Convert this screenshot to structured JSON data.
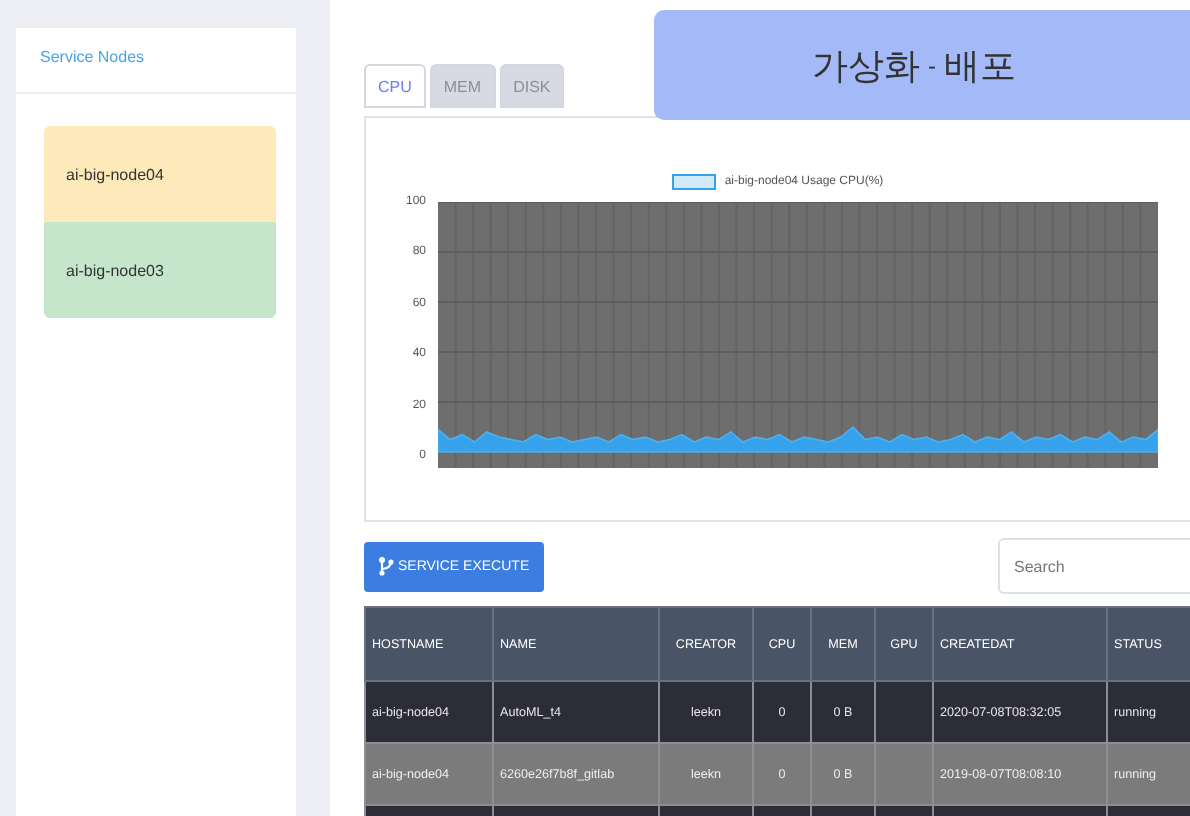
{
  "banner": {
    "title": "가상화",
    "separator": "-",
    "subtitle": "배포"
  },
  "sidebar": {
    "title": "Service Nodes",
    "nodes": [
      {
        "name": "ai-big-node04",
        "color": "#fde9b9"
      },
      {
        "name": "ai-big-node03",
        "color": "#c5e6cb"
      }
    ]
  },
  "tabs": [
    {
      "label": "CPU",
      "selected": true
    },
    {
      "label": "MEM",
      "selected": false
    },
    {
      "label": "DISK",
      "selected": false
    }
  ],
  "chart": {
    "chart_data": {
      "type": "area",
      "grid": true,
      "ylim": [
        0,
        100
      ],
      "yticks": [
        0,
        20,
        40,
        60,
        80,
        100
      ],
      "series": [
        {
          "name": "ai-big-node04 Usage CPU(%)",
          "color": "#36a2eb",
          "values": [
            9,
            5,
            7,
            4,
            8,
            6,
            5,
            4,
            7,
            5,
            6,
            4,
            5,
            6,
            4,
            7,
            5,
            6,
            4,
            5,
            7,
            4,
            6,
            5,
            8,
            4,
            6,
            5,
            7,
            4,
            6,
            5,
            4,
            6,
            10,
            5,
            6,
            4,
            7,
            5,
            6,
            4,
            5,
            7,
            4,
            6,
            5,
            8,
            4,
            6,
            5,
            7,
            4,
            6,
            5,
            8,
            4,
            6,
            5,
            9
          ]
        }
      ]
    }
  },
  "execute_button": {
    "label": "SERVICE EXECUTE"
  },
  "search": {
    "placeholder": "Search"
  },
  "table": {
    "columns": [
      "HOSTNAME",
      "NAME",
      "CREATOR",
      "CPU",
      "MEM",
      "GPU",
      "CREATEDAT",
      "STATUS"
    ],
    "rows": [
      [
        "ai-big-node04",
        "AutoML_t4",
        "leekn",
        "0",
        "0 B",
        "",
        "2020-07-08T08:32:05",
        "running"
      ],
      [
        "ai-big-node04",
        "6260e26f7b8f_gitlab",
        "leekn",
        "0",
        "0 B",
        "",
        "2019-08-07T08:08:10",
        "running"
      ]
    ]
  }
}
